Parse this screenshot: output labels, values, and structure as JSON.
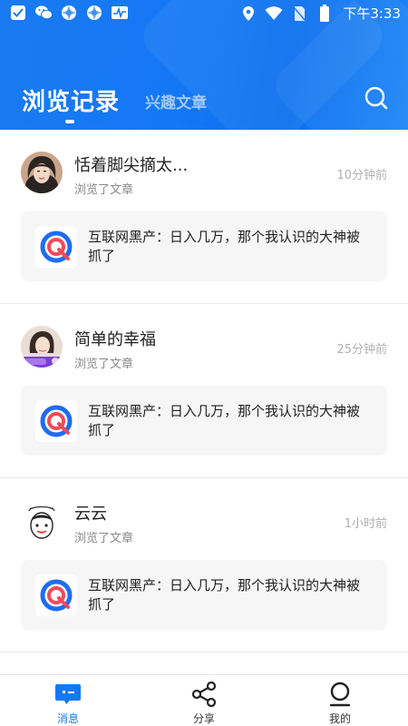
{
  "status_bar": {
    "time": "下午3:33",
    "icons": [
      "check-app-icon",
      "wechat-icon",
      "aperture-icon",
      "aperture-icon",
      "pulse-icon",
      "location-icon",
      "wifi-icon",
      "no-sim-icon",
      "battery-icon"
    ]
  },
  "header": {
    "active_tab": "浏览记录",
    "inactive_tab": "兴趣文章",
    "search_icon": "search-icon",
    "accent_color": "#1478f5"
  },
  "records": [
    {
      "name": "恬着脚尖摘太...",
      "action": "浏览了文章",
      "time": "10分钟前",
      "article_title": "互联网黑产：日入几万，那个我认识的大神被抓了"
    },
    {
      "name": "简单的幸福",
      "action": "浏览了文章",
      "time": "25分钟前",
      "article_title": "互联网黑产：日入几万，那个我认识的大神被抓了"
    },
    {
      "name": "云云",
      "action": "浏览了文章",
      "time": "1小时前",
      "article_title": "互联网黑产：日入几万，那个我认识的大神被抓了"
    }
  ],
  "bottom_nav": [
    {
      "label": "消息",
      "icon": "message-icon",
      "active": true
    },
    {
      "label": "分享",
      "icon": "share-icon",
      "active": false
    },
    {
      "label": "我的",
      "icon": "profile-icon",
      "active": false
    }
  ]
}
